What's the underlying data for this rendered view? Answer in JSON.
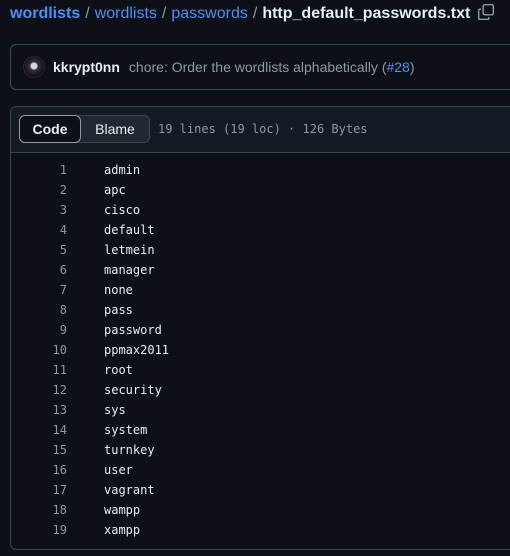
{
  "breadcrumb": {
    "items": [
      "wordlists",
      "wordlists",
      "passwords"
    ],
    "separator": "/",
    "current": "http_default_passwords.txt",
    "copy_icon": "copy-icon"
  },
  "commit": {
    "author": "kkrypt0nn",
    "message": "chore: Order the wordlists alphabetically (",
    "link": "#28",
    "suffix": ")"
  },
  "file": {
    "tabs": [
      "Code",
      "Blame"
    ],
    "active_tab": "Code",
    "meta": "19 lines (19 loc) · 126 Bytes",
    "lines": [
      "admin",
      "apc",
      "cisco",
      "default",
      "letmein",
      "manager",
      "none",
      "pass",
      "password",
      "ppmax2011",
      "root",
      "security",
      "sys",
      "system",
      "turnkey",
      "user",
      "vagrant",
      "wampp",
      "xampp"
    ]
  },
  "colors": {
    "background": "#0d1117",
    "link": "#4493f8",
    "muted": "#9198a1",
    "border": "#3d444d"
  }
}
